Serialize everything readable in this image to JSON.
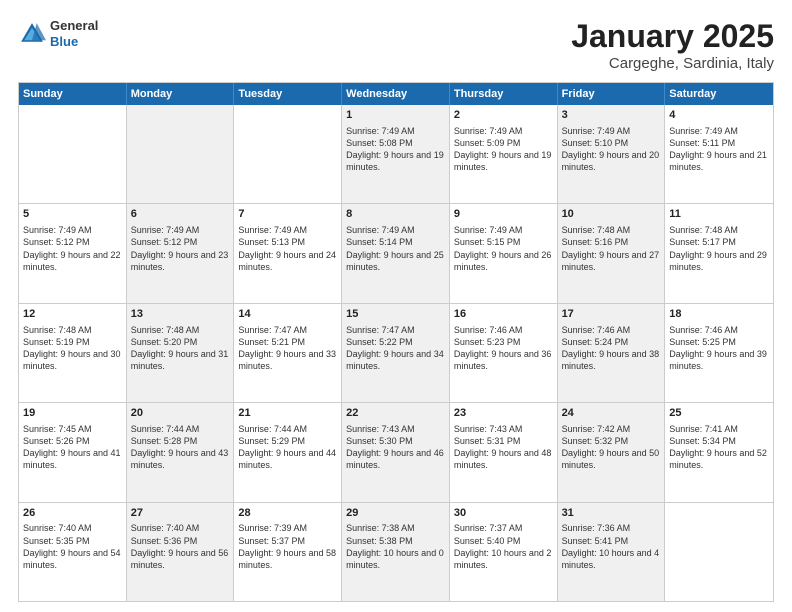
{
  "header": {
    "logo": {
      "general": "General",
      "blue": "Blue"
    },
    "title": "January 2025",
    "location": "Cargeghe, Sardinia, Italy"
  },
  "weekdays": [
    "Sunday",
    "Monday",
    "Tuesday",
    "Wednesday",
    "Thursday",
    "Friday",
    "Saturday"
  ],
  "rows": [
    [
      {
        "day": "",
        "sunrise": "",
        "sunset": "",
        "daylight": "",
        "shaded": false
      },
      {
        "day": "",
        "sunrise": "",
        "sunset": "",
        "daylight": "",
        "shaded": true
      },
      {
        "day": "",
        "sunrise": "",
        "sunset": "",
        "daylight": "",
        "shaded": false
      },
      {
        "day": "1",
        "sunrise": "Sunrise: 7:49 AM",
        "sunset": "Sunset: 5:08 PM",
        "daylight": "Daylight: 9 hours and 19 minutes.",
        "shaded": true
      },
      {
        "day": "2",
        "sunrise": "Sunrise: 7:49 AM",
        "sunset": "Sunset: 5:09 PM",
        "daylight": "Daylight: 9 hours and 19 minutes.",
        "shaded": false
      },
      {
        "day": "3",
        "sunrise": "Sunrise: 7:49 AM",
        "sunset": "Sunset: 5:10 PM",
        "daylight": "Daylight: 9 hours and 20 minutes.",
        "shaded": true
      },
      {
        "day": "4",
        "sunrise": "Sunrise: 7:49 AM",
        "sunset": "Sunset: 5:11 PM",
        "daylight": "Daylight: 9 hours and 21 minutes.",
        "shaded": false
      }
    ],
    [
      {
        "day": "5",
        "sunrise": "Sunrise: 7:49 AM",
        "sunset": "Sunset: 5:12 PM",
        "daylight": "Daylight: 9 hours and 22 minutes.",
        "shaded": false
      },
      {
        "day": "6",
        "sunrise": "Sunrise: 7:49 AM",
        "sunset": "Sunset: 5:12 PM",
        "daylight": "Daylight: 9 hours and 23 minutes.",
        "shaded": true
      },
      {
        "day": "7",
        "sunrise": "Sunrise: 7:49 AM",
        "sunset": "Sunset: 5:13 PM",
        "daylight": "Daylight: 9 hours and 24 minutes.",
        "shaded": false
      },
      {
        "day": "8",
        "sunrise": "Sunrise: 7:49 AM",
        "sunset": "Sunset: 5:14 PM",
        "daylight": "Daylight: 9 hours and 25 minutes.",
        "shaded": true
      },
      {
        "day": "9",
        "sunrise": "Sunrise: 7:49 AM",
        "sunset": "Sunset: 5:15 PM",
        "daylight": "Daylight: 9 hours and 26 minutes.",
        "shaded": false
      },
      {
        "day": "10",
        "sunrise": "Sunrise: 7:48 AM",
        "sunset": "Sunset: 5:16 PM",
        "daylight": "Daylight: 9 hours and 27 minutes.",
        "shaded": true
      },
      {
        "day": "11",
        "sunrise": "Sunrise: 7:48 AM",
        "sunset": "Sunset: 5:17 PM",
        "daylight": "Daylight: 9 hours and 29 minutes.",
        "shaded": false
      }
    ],
    [
      {
        "day": "12",
        "sunrise": "Sunrise: 7:48 AM",
        "sunset": "Sunset: 5:19 PM",
        "daylight": "Daylight: 9 hours and 30 minutes.",
        "shaded": false
      },
      {
        "day": "13",
        "sunrise": "Sunrise: 7:48 AM",
        "sunset": "Sunset: 5:20 PM",
        "daylight": "Daylight: 9 hours and 31 minutes.",
        "shaded": true
      },
      {
        "day": "14",
        "sunrise": "Sunrise: 7:47 AM",
        "sunset": "Sunset: 5:21 PM",
        "daylight": "Daylight: 9 hours and 33 minutes.",
        "shaded": false
      },
      {
        "day": "15",
        "sunrise": "Sunrise: 7:47 AM",
        "sunset": "Sunset: 5:22 PM",
        "daylight": "Daylight: 9 hours and 34 minutes.",
        "shaded": true
      },
      {
        "day": "16",
        "sunrise": "Sunrise: 7:46 AM",
        "sunset": "Sunset: 5:23 PM",
        "daylight": "Daylight: 9 hours and 36 minutes.",
        "shaded": false
      },
      {
        "day": "17",
        "sunrise": "Sunrise: 7:46 AM",
        "sunset": "Sunset: 5:24 PM",
        "daylight": "Daylight: 9 hours and 38 minutes.",
        "shaded": true
      },
      {
        "day": "18",
        "sunrise": "Sunrise: 7:46 AM",
        "sunset": "Sunset: 5:25 PM",
        "daylight": "Daylight: 9 hours and 39 minutes.",
        "shaded": false
      }
    ],
    [
      {
        "day": "19",
        "sunrise": "Sunrise: 7:45 AM",
        "sunset": "Sunset: 5:26 PM",
        "daylight": "Daylight: 9 hours and 41 minutes.",
        "shaded": false
      },
      {
        "day": "20",
        "sunrise": "Sunrise: 7:44 AM",
        "sunset": "Sunset: 5:28 PM",
        "daylight": "Daylight: 9 hours and 43 minutes.",
        "shaded": true
      },
      {
        "day": "21",
        "sunrise": "Sunrise: 7:44 AM",
        "sunset": "Sunset: 5:29 PM",
        "daylight": "Daylight: 9 hours and 44 minutes.",
        "shaded": false
      },
      {
        "day": "22",
        "sunrise": "Sunrise: 7:43 AM",
        "sunset": "Sunset: 5:30 PM",
        "daylight": "Daylight: 9 hours and 46 minutes.",
        "shaded": true
      },
      {
        "day": "23",
        "sunrise": "Sunrise: 7:43 AM",
        "sunset": "Sunset: 5:31 PM",
        "daylight": "Daylight: 9 hours and 48 minutes.",
        "shaded": false
      },
      {
        "day": "24",
        "sunrise": "Sunrise: 7:42 AM",
        "sunset": "Sunset: 5:32 PM",
        "daylight": "Daylight: 9 hours and 50 minutes.",
        "shaded": true
      },
      {
        "day": "25",
        "sunrise": "Sunrise: 7:41 AM",
        "sunset": "Sunset: 5:34 PM",
        "daylight": "Daylight: 9 hours and 52 minutes.",
        "shaded": false
      }
    ],
    [
      {
        "day": "26",
        "sunrise": "Sunrise: 7:40 AM",
        "sunset": "Sunset: 5:35 PM",
        "daylight": "Daylight: 9 hours and 54 minutes.",
        "shaded": false
      },
      {
        "day": "27",
        "sunrise": "Sunrise: 7:40 AM",
        "sunset": "Sunset: 5:36 PM",
        "daylight": "Daylight: 9 hours and 56 minutes.",
        "shaded": true
      },
      {
        "day": "28",
        "sunrise": "Sunrise: 7:39 AM",
        "sunset": "Sunset: 5:37 PM",
        "daylight": "Daylight: 9 hours and 58 minutes.",
        "shaded": false
      },
      {
        "day": "29",
        "sunrise": "Sunrise: 7:38 AM",
        "sunset": "Sunset: 5:38 PM",
        "daylight": "Daylight: 10 hours and 0 minutes.",
        "shaded": true
      },
      {
        "day": "30",
        "sunrise": "Sunrise: 7:37 AM",
        "sunset": "Sunset: 5:40 PM",
        "daylight": "Daylight: 10 hours and 2 minutes.",
        "shaded": false
      },
      {
        "day": "31",
        "sunrise": "Sunrise: 7:36 AM",
        "sunset": "Sunset: 5:41 PM",
        "daylight": "Daylight: 10 hours and 4 minutes.",
        "shaded": true
      },
      {
        "day": "",
        "sunrise": "",
        "sunset": "",
        "daylight": "",
        "shaded": false
      }
    ]
  ]
}
